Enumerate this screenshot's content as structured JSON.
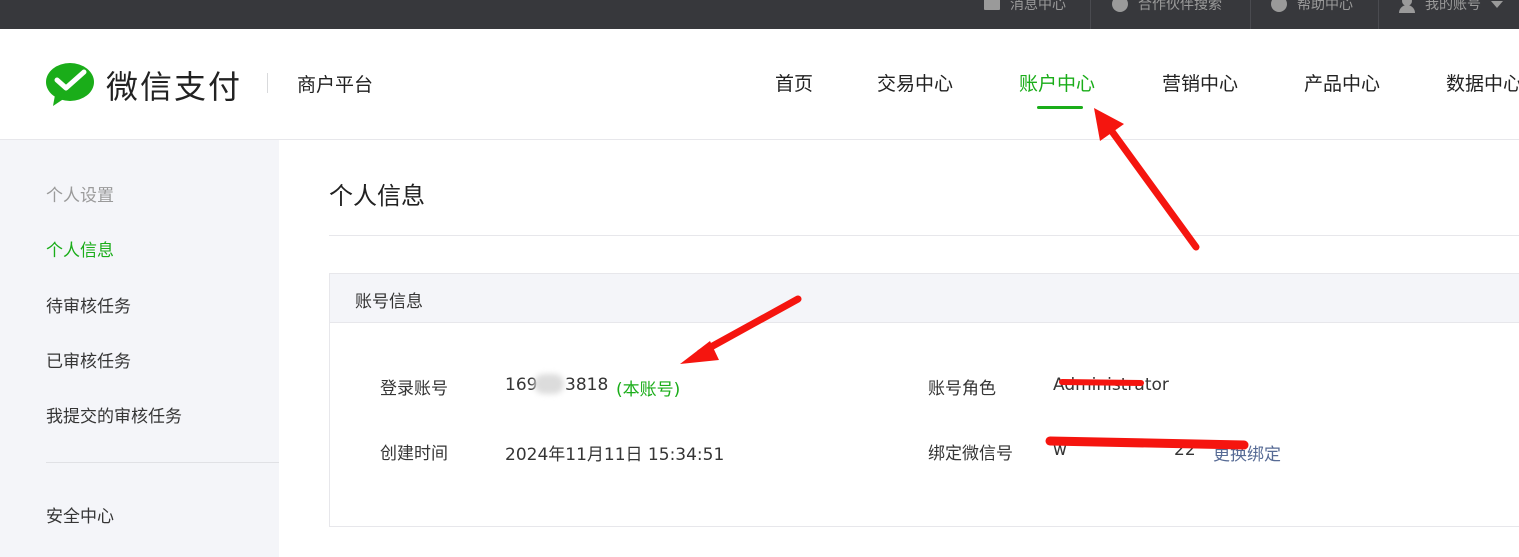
{
  "topbar": {
    "messages": "消息中心",
    "partner_search": "合作伙伴搜索",
    "help": "帮助中心",
    "my_account": "我的账号"
  },
  "header": {
    "logo_text": "微信支付",
    "platform": "商户平台",
    "nav": [
      "首页",
      "交易中心",
      "账户中心",
      "营销中心",
      "产品中心",
      "数据中心"
    ],
    "active_nav": "账户中心"
  },
  "sidebar": {
    "section_title": "个人设置",
    "items": [
      "个人信息",
      "待审核任务",
      "已审核任务",
      "我提交的审核任务"
    ],
    "active_item": "个人信息",
    "bottom_item": "安全中心"
  },
  "main": {
    "page_title": "个人信息",
    "panel_title": "账号信息",
    "login_account_label": "登录账号",
    "login_account_prefix": "169",
    "login_account_suffix": "3818",
    "login_account_tag": "(本账号)",
    "created_label": "创建时间",
    "created_value": "2024年11月11日 15:34:51",
    "role_label": "账号角色",
    "role_value": "Administrator",
    "wechat_label": "绑定微信号",
    "wechat_value_start": "w",
    "wechat_value_end": "22",
    "rebind_link": "更换绑定"
  },
  "colors": {
    "accent_green": "#1aad19",
    "link_blue": "#576b95",
    "annotation_red": "#f5150f",
    "topbar_bg": "#37383c"
  }
}
